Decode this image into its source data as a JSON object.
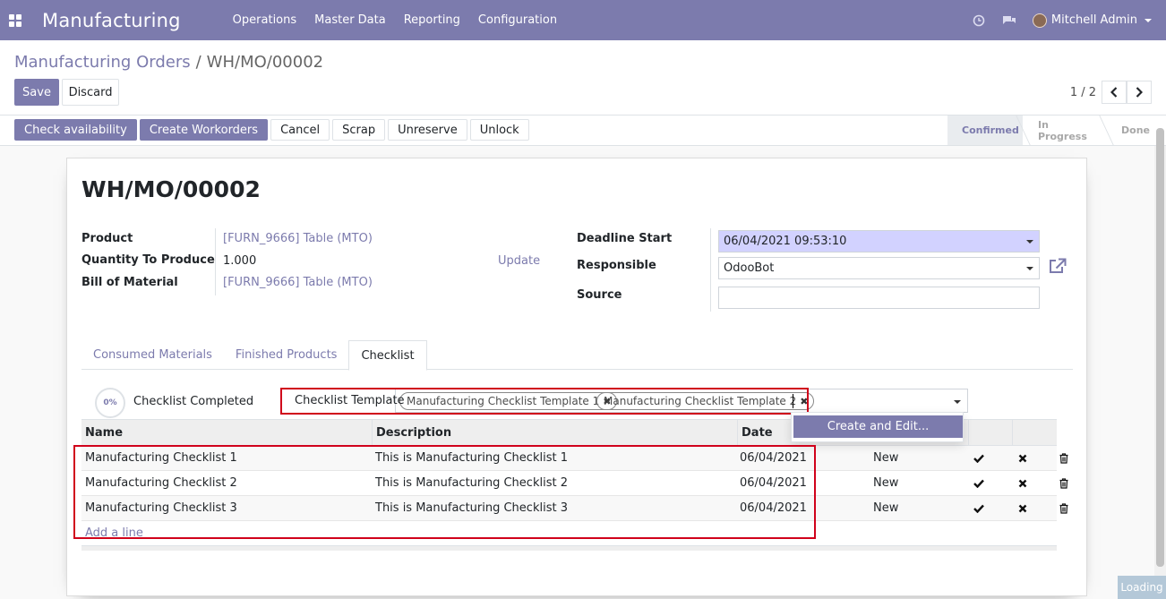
{
  "navbar": {
    "app_name": "Manufacturing",
    "menu": [
      "Operations",
      "Master Data",
      "Reporting",
      "Configuration"
    ],
    "user": "Mitchell Admin",
    "icons": [
      "clock-icon",
      "chat-icon"
    ]
  },
  "breadcrumb": {
    "parent": "Manufacturing Orders",
    "current": "WH/MO/00002"
  },
  "actions": {
    "save": "Save",
    "discard": "Discard"
  },
  "pager": {
    "text": "1 / 2"
  },
  "statusbar": {
    "buttons": [
      "Check availability",
      "Create Workorders",
      "Cancel",
      "Scrap",
      "Unreserve",
      "Unlock"
    ],
    "stages": [
      "Confirmed",
      "In Progress",
      "Done"
    ],
    "active_stage": "Confirmed"
  },
  "form": {
    "title": "WH/MO/00002",
    "product_label": "Product",
    "product_value": "[FURN_9666] Table (MTO)",
    "qty_label": "Quantity To Produce",
    "qty_value": "1.000",
    "update_label": "Update",
    "bom_label": "Bill of Material",
    "bom_value": "[FURN_9666] Table (MTO)",
    "deadline_label": "Deadline Start",
    "deadline_value": "06/04/2021 09:53:10",
    "responsible_label": "Responsible",
    "responsible_value": "OdooBot",
    "source_label": "Source",
    "source_value": ""
  },
  "tabs": [
    "Consumed Materials",
    "Finished Products",
    "Checklist"
  ],
  "active_tab": "Checklist",
  "checklist": {
    "progress": "0%",
    "completed_label": "Checklist Completed",
    "template_label": "Checklist Template",
    "tags": [
      "Manufacturing Checklist Template 1",
      "Manufacturing Checklist Template 2"
    ],
    "dropdown_item": "Create and Edit...",
    "columns": [
      "Name",
      "Description",
      "Date"
    ],
    "rows": [
      {
        "name": "Manufacturing Checklist 1",
        "description": "This is Manufacturing Checklist 1",
        "date": "06/04/2021",
        "state": "New"
      },
      {
        "name": "Manufacturing Checklist 2",
        "description": "This is Manufacturing Checklist 2",
        "date": "06/04/2021",
        "state": "New"
      },
      {
        "name": "Manufacturing Checklist 3",
        "description": "This is Manufacturing Checklist 3",
        "date": "06/04/2021",
        "state": "New"
      }
    ],
    "add_line": "Add a line"
  },
  "loading": "Loading",
  "colors": {
    "brand": "#7c7bad",
    "highlight": "#d0021b"
  }
}
